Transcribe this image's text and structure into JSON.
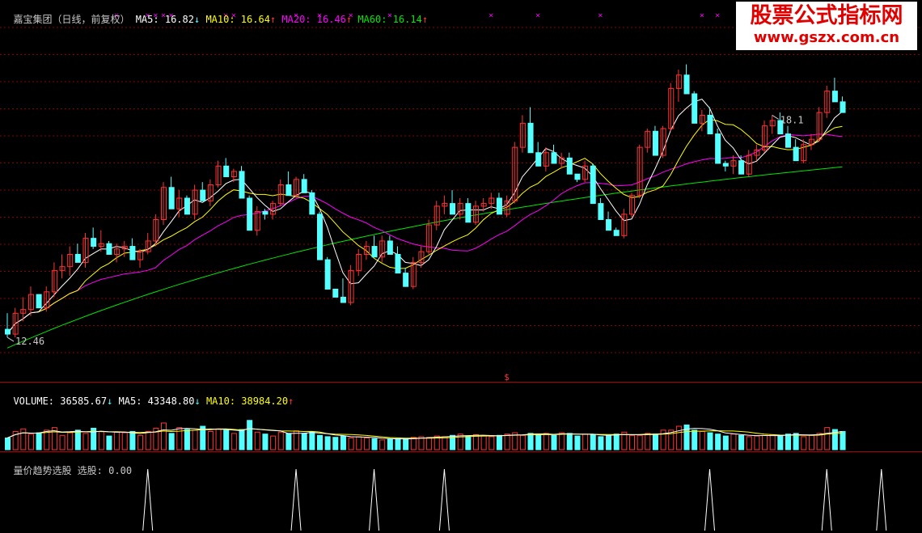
{
  "price_header": {
    "name": "嘉宝集团（日线，前复权）",
    "ma5_label": "MA5:",
    "ma5_value": "16.82",
    "ma5_arrow": "↓",
    "ma10_label": "MA10:",
    "ma10_value": "16.64",
    "ma10_arrow": "↑",
    "ma20_label": "MA20:",
    "ma20_value": "16.46",
    "ma20_arrow": "↑",
    "ma60_label": "MA60:",
    "ma60_value": "16.14",
    "ma60_arrow": "↑"
  },
  "volume_header": {
    "label": "VOLUME:",
    "value": "36585.67",
    "value_arrow": "↓",
    "ma5_label": "MA5:",
    "ma5_value": "43348.80",
    "ma5_arrow": "↓",
    "ma10_label": "MA10:",
    "ma10_value": "38984.20",
    "ma10_arrow": "↑"
  },
  "indicator_header": {
    "label": "量价趋势选股 选股:",
    "value": "0.00"
  },
  "watermark": {
    "title": "股票公式指标网",
    "url": "www.gszx.com.cn"
  },
  "colors": {
    "up": "#ff3232",
    "down": "#54ffff",
    "ma5": "#ffffff",
    "ma10": "#ffff00",
    "ma20": "#ff00ff",
    "ma60": "#00e600",
    "grid": "#8b0000",
    "signal": "#ffffff",
    "background": "#000000"
  },
  "chart_data": [
    {
      "type": "candlestick",
      "title": "嘉宝集团（日线，前复权）",
      "y_range": [
        11.6,
        18.4
      ],
      "grid": true,
      "annotations": [
        {
          "text": "12.46",
          "kind": "low",
          "index": 0
        },
        {
          "text": "18.1",
          "kind": "high",
          "index": 98
        }
      ],
      "markers": {
        "symbol": "×",
        "color": "#ff00ff",
        "indices": [
          14,
          18,
          19,
          20,
          21,
          28,
          29,
          37,
          40,
          44,
          49,
          62,
          68,
          76,
          89,
          91,
          100,
          105
        ]
      },
      "dollar_marker": {
        "text": "$",
        "index": 64
      },
      "ohlc": [
        [
          12.55,
          12.85,
          12.4,
          12.46
        ],
        [
          12.46,
          12.95,
          12.4,
          12.85
        ],
        [
          12.85,
          13.15,
          12.7,
          12.92
        ],
        [
          12.92,
          13.35,
          12.8,
          13.2
        ],
        [
          13.2,
          13.1,
          13.2,
          12.95
        ],
        [
          12.95,
          13.35,
          12.88,
          13.25
        ],
        [
          13.25,
          13.8,
          13.15,
          13.65
        ],
        [
          13.65,
          13.95,
          13.5,
          13.72
        ],
        [
          13.72,
          14.1,
          13.55,
          13.95
        ],
        [
          13.95,
          13.9,
          14.15,
          13.8
        ],
        [
          13.8,
          14.35,
          13.7,
          14.25
        ],
        [
          14.25,
          14.45,
          14.05,
          14.1
        ],
        [
          14.1,
          14.4,
          14.0,
          14.15
        ],
        [
          14.15,
          14.2,
          14.0,
          13.95
        ],
        [
          13.95,
          14.15,
          13.8,
          14.05
        ],
        [
          14.05,
          14.2,
          13.9,
          14.1
        ],
        [
          14.1,
          14.05,
          14.25,
          13.85
        ],
        [
          13.85,
          14.05,
          13.7,
          14.0
        ],
        [
          14.0,
          14.35,
          13.95,
          14.2
        ],
        [
          14.2,
          14.7,
          14.1,
          14.6
        ],
        [
          14.6,
          15.3,
          14.5,
          15.2
        ],
        [
          15.2,
          15.25,
          15.4,
          14.8
        ],
        [
          14.8,
          15.15,
          14.65,
          15.0
        ],
        [
          15.0,
          14.75,
          15.05,
          14.7
        ],
        [
          14.7,
          15.25,
          14.6,
          15.15
        ],
        [
          15.15,
          15.1,
          15.3,
          14.95
        ],
        [
          14.95,
          15.35,
          14.85,
          15.25
        ],
        [
          15.25,
          15.7,
          15.2,
          15.6
        ],
        [
          15.6,
          15.55,
          15.75,
          15.4
        ],
        [
          15.4,
          15.55,
          15.3,
          15.5
        ],
        [
          15.5,
          15.1,
          15.6,
          15.0
        ],
        [
          15.0,
          14.5,
          15.05,
          14.4
        ],
        [
          14.4,
          14.85,
          14.3,
          14.75
        ],
        [
          14.75,
          14.8,
          14.6,
          14.7
        ],
        [
          14.7,
          14.95,
          14.6,
          14.9
        ],
        [
          14.9,
          15.35,
          14.85,
          15.25
        ],
        [
          15.25,
          15.3,
          15.5,
          15.05
        ],
        [
          15.05,
          15.4,
          15.0,
          15.35
        ],
        [
          15.35,
          15.2,
          15.45,
          15.1
        ],
        [
          15.1,
          14.8,
          15.15,
          14.7
        ],
        [
          14.7,
          14.1,
          14.75,
          13.85
        ],
        [
          13.85,
          13.4,
          13.9,
          13.3
        ],
        [
          13.3,
          13.25,
          13.2,
          13.15
        ],
        [
          13.15,
          13.1,
          13.5,
          13.05
        ],
        [
          13.05,
          13.75,
          13.0,
          13.65
        ],
        [
          13.65,
          14.05,
          13.55,
          13.95
        ],
        [
          13.95,
          14.2,
          13.85,
          14.1
        ],
        [
          14.1,
          14.0,
          14.3,
          13.9
        ],
        [
          13.9,
          14.3,
          13.8,
          14.2
        ],
        [
          14.2,
          14.1,
          14.3,
          13.95
        ],
        [
          13.95,
          13.75,
          14.1,
          13.6
        ],
        [
          13.6,
          13.4,
          13.7,
          13.35
        ],
        [
          13.35,
          13.9,
          13.3,
          13.8
        ],
        [
          13.8,
          14.1,
          13.7,
          14.0
        ],
        [
          14.0,
          14.6,
          13.95,
          14.5
        ],
        [
          14.5,
          14.95,
          14.4,
          14.85
        ],
        [
          14.85,
          15.05,
          14.7,
          14.9
        ],
        [
          14.9,
          14.85,
          15.15,
          14.7
        ],
        [
          14.7,
          15.0,
          14.6,
          14.9
        ],
        [
          14.9,
          14.65,
          15.0,
          14.55
        ],
        [
          14.55,
          14.95,
          14.5,
          14.85
        ],
        [
          14.85,
          15.0,
          14.75,
          14.9
        ],
        [
          14.9,
          15.1,
          14.8,
          15.0
        ],
        [
          15.0,
          14.8,
          15.1,
          14.7
        ],
        [
          14.7,
          15.05,
          14.65,
          14.95
        ],
        [
          14.95,
          16.05,
          14.9,
          15.95
        ],
        [
          15.95,
          16.55,
          15.85,
          16.4
        ],
        [
          16.4,
          16.05,
          16.7,
          15.85
        ],
        [
          15.85,
          15.75,
          16.05,
          15.6
        ],
        [
          15.6,
          15.95,
          15.5,
          15.85
        ],
        [
          15.85,
          15.8,
          16.0,
          15.65
        ],
        [
          15.65,
          15.85,
          15.55,
          15.75
        ],
        [
          15.75,
          15.6,
          15.85,
          15.45
        ],
        [
          15.45,
          15.45,
          15.3,
          15.35
        ],
        [
          15.35,
          15.7,
          15.3,
          15.6
        ],
        [
          15.6,
          15.0,
          15.65,
          14.9
        ],
        [
          14.9,
          14.7,
          15.0,
          14.6
        ],
        [
          14.6,
          14.5,
          14.75,
          14.4
        ],
        [
          14.4,
          14.45,
          14.35,
          14.3
        ],
        [
          14.3,
          14.8,
          14.25,
          14.7
        ],
        [
          14.7,
          15.1,
          14.65,
          15.05
        ],
        [
          15.05,
          16.0,
          15.0,
          15.95
        ],
        [
          15.95,
          16.3,
          15.85,
          16.25
        ],
        [
          16.25,
          15.95,
          16.35,
          15.8
        ],
        [
          15.8,
          16.35,
          15.75,
          16.3
        ],
        [
          16.3,
          17.15,
          16.25,
          17.05
        ],
        [
          17.05,
          17.4,
          16.8,
          17.3
        ],
        [
          17.3,
          17.2,
          17.5,
          16.95
        ],
        [
          16.95,
          16.55,
          17.0,
          16.4
        ],
        [
          16.4,
          16.65,
          16.25,
          16.55
        ],
        [
          16.55,
          16.35,
          16.7,
          16.2
        ],
        [
          16.2,
          15.75,
          16.3,
          15.65
        ],
        [
          15.65,
          15.7,
          15.5,
          15.6
        ],
        [
          15.6,
          15.8,
          15.45,
          15.7
        ],
        [
          15.7,
          15.55,
          15.8,
          15.45
        ],
        [
          15.45,
          15.9,
          15.4,
          15.8
        ],
        [
          15.8,
          16.0,
          15.7,
          15.9
        ],
        [
          15.9,
          16.45,
          15.85,
          16.35
        ],
        [
          16.35,
          16.55,
          16.2,
          16.45
        ],
        [
          16.45,
          16.3,
          16.6,
          16.2
        ],
        [
          16.2,
          16.05,
          16.35,
          15.95
        ],
        [
          15.95,
          15.8,
          16.1,
          15.7
        ],
        [
          15.7,
          16.1,
          15.65,
          16.0
        ],
        [
          16.0,
          16.2,
          15.9,
          16.1
        ],
        [
          16.1,
          16.7,
          16.05,
          16.6
        ],
        [
          16.6,
          17.1,
          16.5,
          17.0
        ],
        [
          17.0,
          16.9,
          17.25,
          16.8
        ],
        [
          16.8,
          16.75,
          16.9,
          16.6
        ]
      ]
    },
    {
      "type": "bar",
      "title": "VOLUME",
      "y_range": [
        0,
        82000
      ],
      "values": [
        18000,
        28000,
        32000,
        24000,
        26000,
        30000,
        34000,
        22000,
        26000,
        30000,
        25000,
        33000,
        28000,
        21000,
        27000,
        26000,
        28000,
        22000,
        28000,
        33000,
        41000,
        25000,
        34000,
        31000,
        30000,
        36000,
        28000,
        32000,
        30000,
        25000,
        31000,
        45000,
        27000,
        24000,
        21000,
        27000,
        25000,
        29000,
        25000,
        27000,
        22000,
        20000,
        19000,
        21000,
        18000,
        20000,
        18000,
        17000,
        15000,
        16000,
        17000,
        17000,
        19000,
        20000,
        19000,
        21000,
        20000,
        22000,
        24000,
        21000,
        23000,
        21000,
        20000,
        22000,
        24000,
        26000,
        22000,
        25000,
        24000,
        25000,
        22000,
        26000,
        25000,
        21000,
        24000,
        23000,
        20000,
        22000,
        24000,
        27000,
        22000,
        22000,
        25000,
        24000,
        30000,
        30000,
        36000,
        38000,
        30000,
        28000,
        26000,
        24000,
        21000,
        24000,
        22000,
        20000,
        21000,
        22000,
        23000,
        22000,
        24000,
        25000,
        20000,
        22000,
        25000,
        34000,
        31000,
        28000,
        26000,
        27000
      ]
    },
    {
      "type": "line",
      "title": "量价趋势选股",
      "series": [
        {
          "name": "选股",
          "signal_indices": [
            18,
            37,
            47,
            56,
            90,
            105,
            112
          ]
        }
      ],
      "y_range": [
        0,
        1
      ]
    }
  ]
}
